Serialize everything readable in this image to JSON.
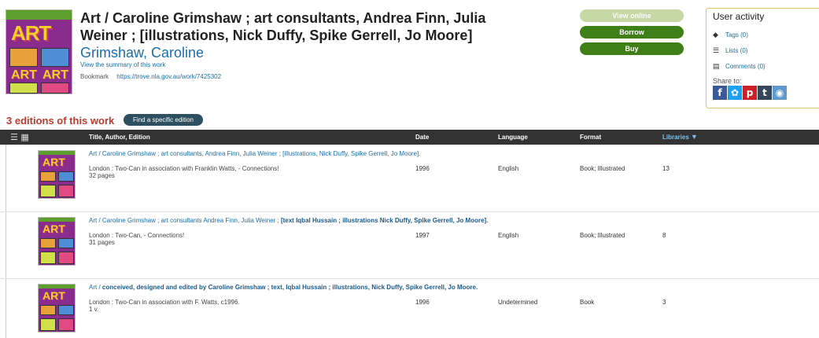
{
  "work": {
    "title": "Art / Caroline Grimshaw ; art consultants, Andrea Finn, Julia Weiner ; [illustrations, Nick Duffy, Spike Gerrell, Jo Moore]",
    "author": "Grimshaw, Caroline",
    "summary_link": "View the summary of this work",
    "bookmark_label": "Bookmark",
    "bookmark_url": "https://trove.nla.gov.au/work/7425302",
    "cover_text": "ART"
  },
  "actions": {
    "view_online": "View online",
    "borrow": "Borrow",
    "buy": "Buy"
  },
  "user_activity": {
    "heading": "User activity",
    "tags": "Tags (0)",
    "lists": "Lists (0)",
    "comments": "Comments (0)",
    "share_label": "Share to:",
    "share_icons": [
      "f",
      "t-bird",
      "p",
      "t",
      "reddit"
    ]
  },
  "editions": {
    "heading": "3 editions of this work",
    "find_button": "Find a specific edition",
    "columns": {
      "title": "Title, Author, Edition",
      "date": "Date",
      "language": "Language",
      "format": "Format",
      "libraries": "Libraries"
    },
    "rows": [
      {
        "title_normal": "Art / Caroline Grimshaw ; art consultants, Andrea Finn, Julia Weiner ; [illustrations, Nick Duffy, Spike Gerrell, Jo Moore].",
        "title_bold": "",
        "publisher": "London : Two-Can in association with Franklin Watts, - Connections!",
        "extent": "32 pages",
        "date": "1996",
        "language": "English",
        "format": "Book; Illustrated",
        "libraries": "13"
      },
      {
        "title_normal": "Art / Caroline Grimshaw ; art consultants Andrea Finn, Julia Weiner ; ",
        "title_bold": "[text Iqbal Hussain ; illustrations Nick Duffy, Spike Gerrell, Jo Moore].",
        "publisher": "London : Two-Can, - Connections!",
        "extent": "31 pages",
        "date": "1997",
        "language": "English",
        "format": "Book; Illustrated",
        "libraries": "8"
      },
      {
        "title_normal": "Art / ",
        "title_bold": "conceived, designed and edited by Caroline Grimshaw ; text, Iqbal Hussain ; illustrations, Nick Duffy, Spike Gerrell, Jo Moore.",
        "publisher": "London : Two-Can in association with F. Watts, c1996.",
        "extent": "1 v.",
        "date": "1996",
        "language": "Undetermined",
        "format": "Book",
        "libraries": "3"
      }
    ]
  },
  "colors": {
    "link": "#1a6fad",
    "heading_red": "#c0392b",
    "green_button": "#3f7f17",
    "green_disabled": "#c5d8a6",
    "table_header": "#333333"
  }
}
